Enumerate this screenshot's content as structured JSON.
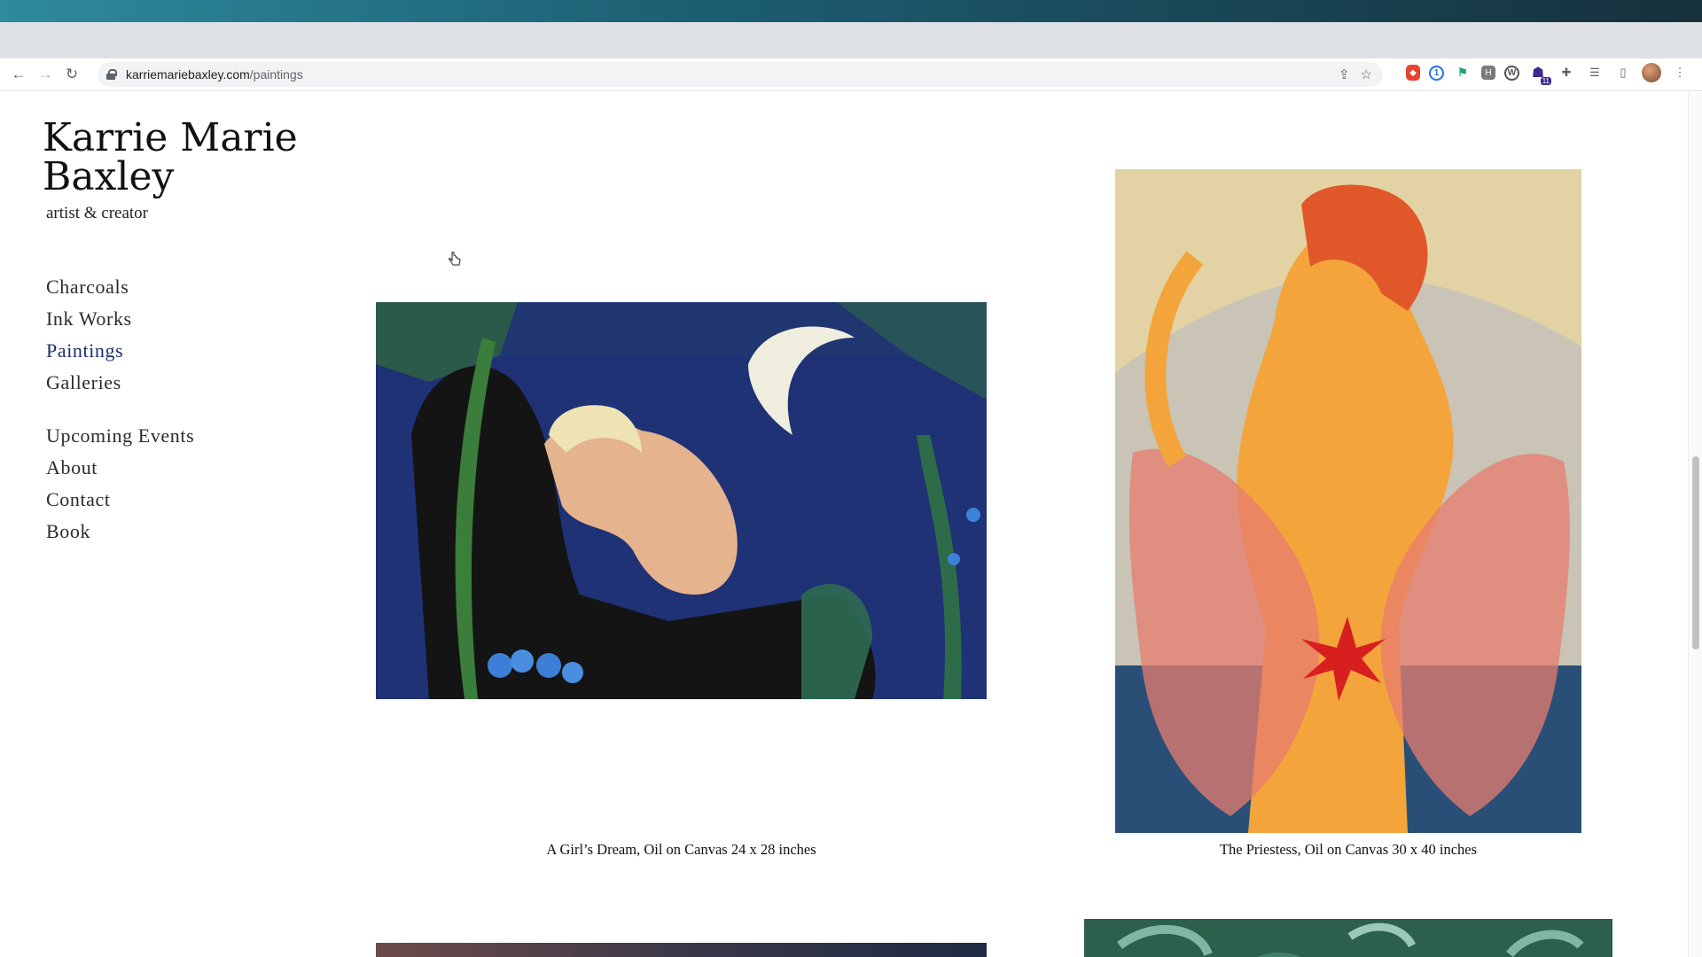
{
  "browser": {
    "url_host": "karriemariebaxley.com",
    "url_path": "/paintings",
    "extension_badge_count": "11"
  },
  "site": {
    "title": "Karrie Marie Baxley",
    "tagline": "artist & creator"
  },
  "nav": {
    "primary": [
      "Charcoals",
      "Ink Works",
      "Paintings",
      "Galleries"
    ],
    "secondary": [
      "Upcoming Events",
      "About",
      "Contact",
      "Book"
    ],
    "active": "Paintings"
  },
  "artworks": [
    {
      "caption": "A Girl’s Dream, Oil on Canvas 24 x 28 inches"
    },
    {
      "caption": "The Priestess, Oil on Canvas 30 x 40 inches"
    }
  ],
  "colors": {
    "nav_active": "#1c2f6b",
    "text": "#2b2b2b"
  }
}
